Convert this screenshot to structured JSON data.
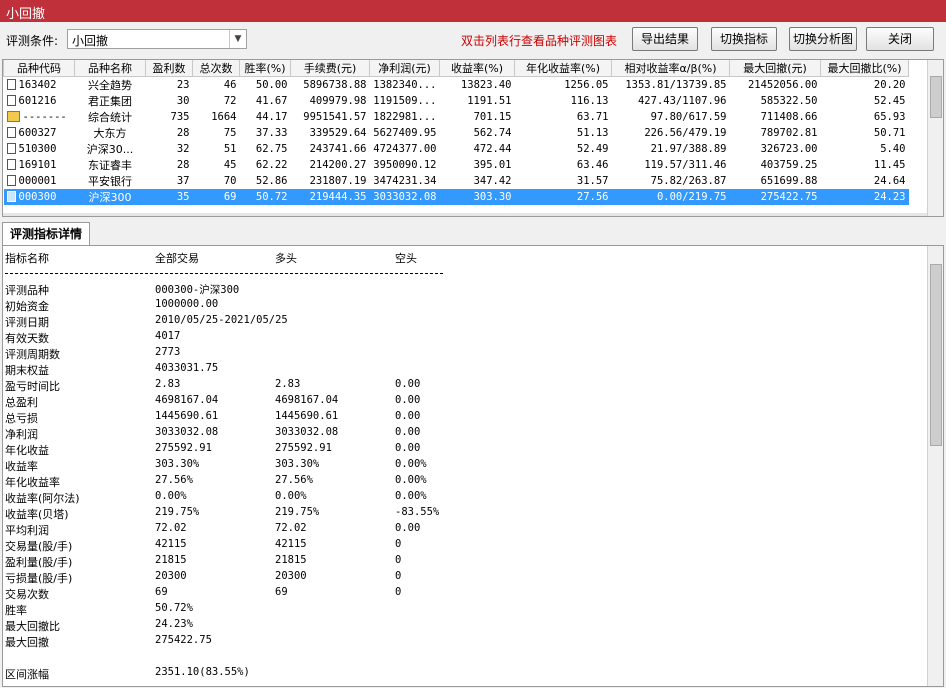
{
  "window": {
    "title": "小回撤"
  },
  "toolbar": {
    "condition_label": "评测条件:",
    "condition_value": "小回撤",
    "hint": "双击列表行查看品种评测图表",
    "buttons": [
      "导出结果",
      "切换指标",
      "切换分析图",
      "关闭"
    ]
  },
  "grid": {
    "columns": [
      "品种代码",
      "品种名称",
      "盈利数",
      "总次数",
      "胜率(%)",
      "手续费(元)",
      "净利润(元)",
      "收益率(%)",
      "年化收益率(%)",
      "相对收益率α/β(%)",
      "最大回撤(元)",
      "最大回撤比(%)"
    ],
    "rows": [
      {
        "icon": "doc",
        "cells": [
          "163402",
          "兴全趋势",
          "23",
          "46",
          "50.00",
          "5896738.88",
          "1382340...",
          "13823.40",
          "1256.05",
          "1353.81/13739.85",
          "21452056.00",
          "20.20"
        ]
      },
      {
        "icon": "doc",
        "cells": [
          "601216",
          "君正集团",
          "30",
          "72",
          "41.67",
          "409979.98",
          "1191509...",
          "1191.51",
          "116.13",
          "427.43/1107.96",
          "585322.50",
          "52.45"
        ]
      },
      {
        "icon": "folder",
        "cells": [
          "-------",
          "综合统计",
          "735",
          "1664",
          "44.17",
          "9951541.57",
          "1822981...",
          "701.15",
          "63.71",
          "97.80/617.59",
          "711408.66",
          "65.93"
        ]
      },
      {
        "icon": "doc",
        "cells": [
          "600327",
          "大东方",
          "28",
          "75",
          "37.33",
          "339529.64",
          "5627409.95",
          "562.74",
          "51.13",
          "226.56/479.19",
          "789702.81",
          "50.71"
        ]
      },
      {
        "icon": "doc",
        "cells": [
          "510300",
          "沪深30...",
          "32",
          "51",
          "62.75",
          "243741.66",
          "4724377.00",
          "472.44",
          "52.49",
          "21.97/388.89",
          "326723.00",
          "5.40"
        ]
      },
      {
        "icon": "doc",
        "cells": [
          "169101",
          "东证睿丰",
          "28",
          "45",
          "62.22",
          "214200.27",
          "3950090.12",
          "395.01",
          "63.46",
          "119.57/311.46",
          "403759.25",
          "11.45"
        ]
      },
      {
        "icon": "doc",
        "cells": [
          "000001",
          "平安银行",
          "37",
          "70",
          "52.86",
          "231807.19",
          "3474231.34",
          "347.42",
          "31.57",
          "75.82/263.87",
          "651699.88",
          "24.64"
        ]
      },
      {
        "icon": "doc",
        "selected": true,
        "cells": [
          "000300",
          "沪深300",
          "35",
          "69",
          "50.72",
          "219444.35",
          "3033032.08",
          "303.30",
          "27.56",
          "0.00/219.75",
          "275422.75",
          "24.23"
        ]
      }
    ]
  },
  "tab": {
    "label": "评测指标详情"
  },
  "detail": {
    "header": [
      "指标名称",
      "全部交易",
      "多头",
      "空头"
    ],
    "separator": "------------------------------------------------------------------------",
    "rows": [
      [
        "评测品种",
        "000300-沪深300",
        "",
        ""
      ],
      [
        "初始资金",
        "1000000.00",
        "",
        ""
      ],
      [
        "评测日期",
        "2010/05/25-2021/05/25",
        "",
        ""
      ],
      [
        "有效天数",
        "4017",
        "",
        ""
      ],
      [
        "评测周期数",
        "2773",
        "",
        ""
      ],
      [
        "期末权益",
        "4033031.75",
        "",
        ""
      ],
      [
        "盈亏时间比",
        "2.83",
        "2.83",
        "0.00"
      ],
      [
        "总盈利",
        "4698167.04",
        "4698167.04",
        "0.00"
      ],
      [
        "总亏损",
        "1445690.61",
        "1445690.61",
        "0.00"
      ],
      [
        "净利润",
        "3033032.08",
        "3033032.08",
        "0.00"
      ],
      [
        "年化收益",
        "275592.91",
        "275592.91",
        "0.00"
      ],
      [
        "收益率",
        "303.30%",
        "303.30%",
        "0.00%"
      ],
      [
        "年化收益率",
        "27.56%",
        "27.56%",
        "0.00%"
      ],
      [
        "收益率(阿尔法)",
        "0.00%",
        "0.00%",
        "0.00%"
      ],
      [
        "收益率(贝塔)",
        "219.75%",
        "219.75%",
        "-83.55%"
      ],
      [
        "平均利润",
        "72.02",
        "72.02",
        "0.00"
      ],
      [
        "交易量(股/手)",
        "42115",
        "42115",
        "0"
      ],
      [
        "盈利量(股/手)",
        "21815",
        "21815",
        "0"
      ],
      [
        "亏损量(股/手)",
        "20300",
        "20300",
        "0"
      ],
      [
        "交易次数",
        "69",
        "69",
        "0"
      ],
      [
        "胜率",
        "50.72%",
        "",
        ""
      ],
      [
        "最大回撤比",
        "24.23%",
        "",
        ""
      ],
      [
        "最大回撤",
        "275422.75",
        "",
        ""
      ],
      [
        "",
        "",
        "",
        ""
      ],
      [
        "区间涨幅",
        "2351.10(83.55%)",
        "",
        ""
      ]
    ]
  }
}
